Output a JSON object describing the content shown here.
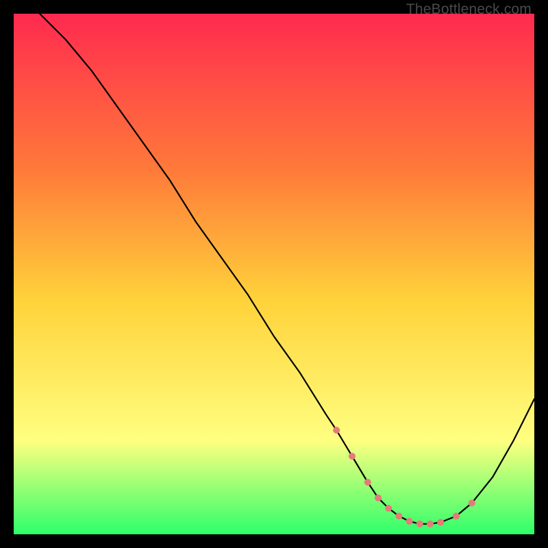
{
  "watermark": "TheBottleneck.com",
  "colors": {
    "background": "#000000",
    "gradient_top": "#ff2a4f",
    "gradient_mid1": "#ff7a3a",
    "gradient_mid2": "#ffd23a",
    "gradient_mid3": "#ffff80",
    "gradient_bottom": "#2eff6a",
    "curve": "#000000",
    "dots": "#e67a7a"
  },
  "chart_data": {
    "type": "line",
    "title": "",
    "xlabel": "",
    "ylabel": "",
    "xlim": [
      0,
      100
    ],
    "ylim": [
      0,
      100
    ],
    "series": [
      {
        "name": "curve",
        "x": [
          5,
          10,
          15,
          20,
          25,
          30,
          35,
          40,
          45,
          50,
          55,
          60,
          62,
          65,
          68,
          70,
          72,
          74,
          76,
          78,
          80,
          82,
          85,
          88,
          92,
          96,
          100
        ],
        "y": [
          100,
          95,
          89,
          82,
          75,
          68,
          60,
          53,
          46,
          38,
          31,
          23,
          20,
          15,
          10,
          7,
          5,
          3.5,
          2.5,
          2,
          2,
          2.3,
          3.5,
          6,
          11,
          18,
          26
        ]
      }
    ],
    "highlight_points": {
      "name": "dots",
      "x": [
        62,
        65,
        68,
        70,
        72,
        74,
        76,
        78,
        80,
        82,
        85,
        88
      ],
      "y": [
        20,
        15,
        10,
        7,
        5,
        3.5,
        2.5,
        2,
        2,
        2.3,
        3.5,
        6
      ]
    }
  }
}
